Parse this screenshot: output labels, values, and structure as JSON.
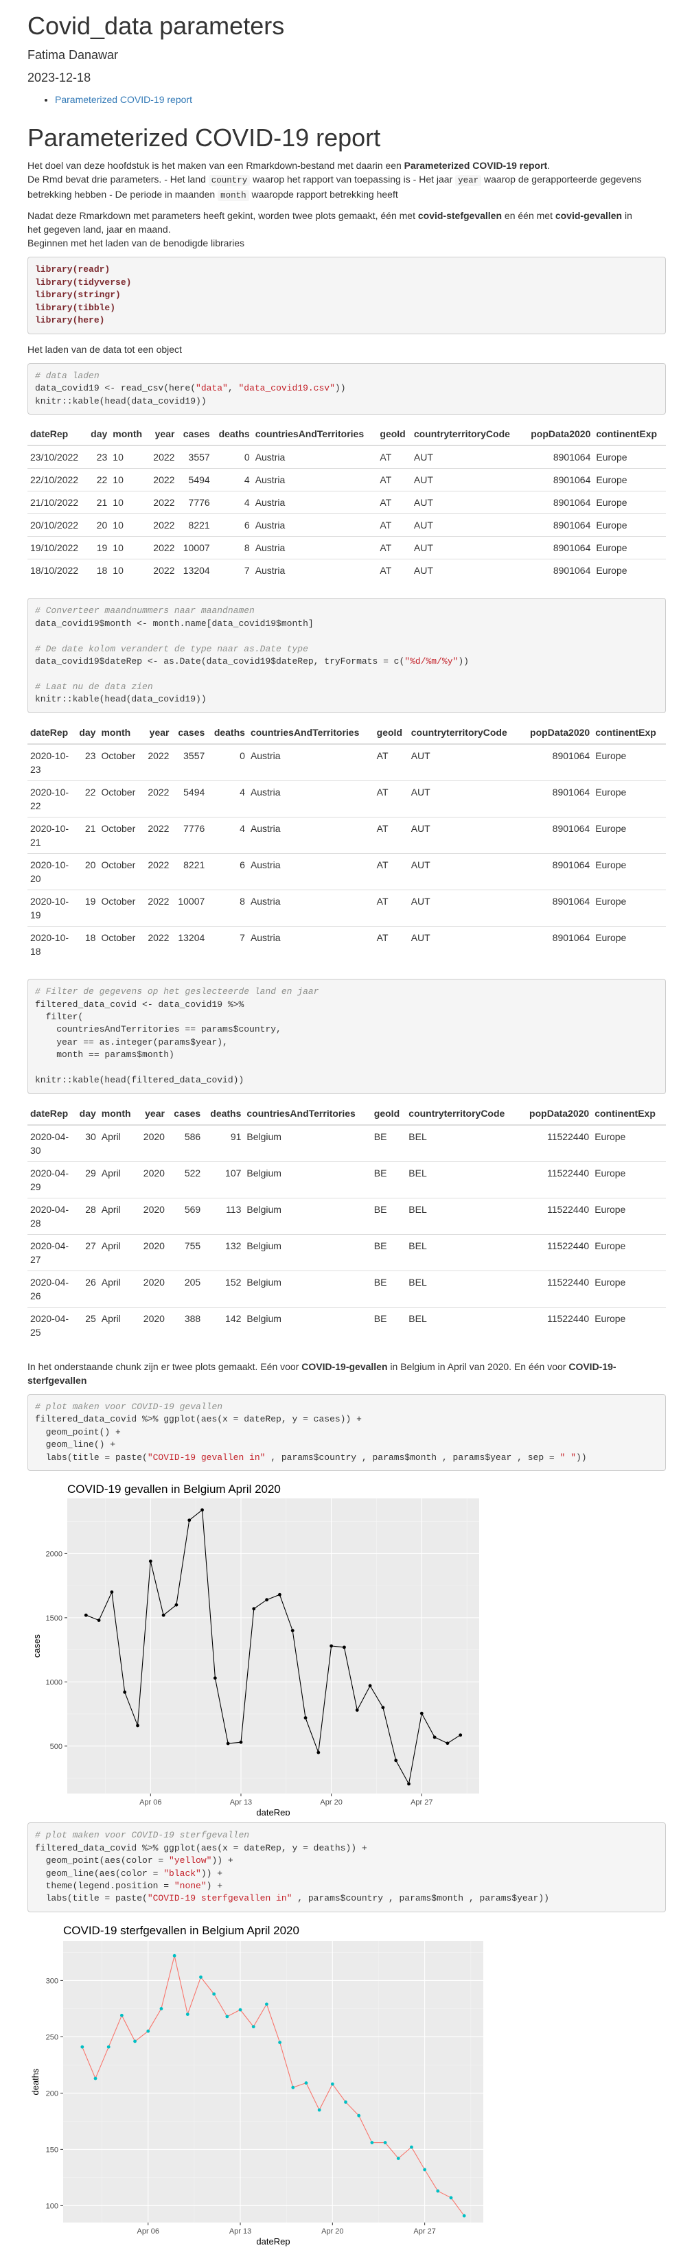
{
  "title": "Covid_data parameters",
  "author": "Fatima Danawar",
  "date": "2023-12-18",
  "toc": [
    "Parameterized COVID-19 report"
  ],
  "section_title": "Parameterized COVID-19 report",
  "intro": {
    "p1_a": "Het doel van deze hoofdstuk is het maken van een Rmarkdown-bestand met daarin een ",
    "p1_b": "Parameterized COVID-19 report",
    "p1_c": ".",
    "p1_d": "De Rmd bevat drie parameters. - Het land ",
    "p1_code1": "country",
    "p1_e": " waarop het rapport van toepassing is - Het jaar ",
    "p1_code2": "year",
    "p1_f": " waarop de gerapporteerde gegevens betrekking hebben - De periode in maanden ",
    "p1_code3": "month",
    "p1_g": " waaropde rapport betrekking heeft",
    "p2_a": "Nadat deze Rmarkdown met parameters heeft gekint, worden twee plots gemaakt, één met ",
    "p2_b": "covid-stefgevallen",
    "p2_c": " en één met ",
    "p2_d": "covid-gevallen",
    "p2_e": " in het gegeven land, jaar en maand.",
    "p2_f": "Beginnen met het laden van de benodigde libraries",
    "p3": "Het laden van de data tot een object",
    "p4_a": "In het onderstaande chunk zijn er twee plots gemaakt. Eén voor ",
    "p4_b": "COVID-19-gevallen",
    "p4_c": " in Belgium in April van 2020. En één voor ",
    "p4_d": "COVID-19-sterfgevallen"
  },
  "code": {
    "libs": [
      "library(readr)",
      "library(tidyverse)",
      "library(stringr)",
      "library(tibble)",
      "library(here)"
    ],
    "load_comment": "# data laden",
    "load_a": "data_covid19 <- read_csv(here(",
    "load_s1": "\"data\"",
    "load_b": ", ",
    "load_s2": "\"data_covid19.csv\"",
    "load_c": "))",
    "load_d": "knitr::kable(head(data_covid19))",
    "conv_c1": "# Converteer maandnummers naar maandnamen",
    "conv_1": "data_covid19$month <- month.name[data_covid19$month]",
    "conv_c2": "# De date kolom verandert de type naar as.Date type",
    "conv_2a": "data_covid19$dateRep <- as.Date(data_covid19$dateRep, tryFormats = c(",
    "conv_2s": "\"%d/%m/%y\"",
    "conv_2b": "))",
    "conv_c3": "# Laat nu de data zien",
    "conv_3": "knitr::kable(head(data_covid19))",
    "filt_c": "# Filter de gegevens op het geslecteerde land en jaar",
    "filt_1": "filtered_data_covid <- data_covid19 %>%",
    "filt_2": "  filter(",
    "filt_3": "    countriesAndTerritories == params$country,",
    "filt_4": "    year == as.integer(params$year),",
    "filt_5": "    month == params$month)",
    "filt_6": "knitr::kable(head(filtered_data_covid))",
    "p1_c": "# plot maken voor COVID-19 gevallen",
    "p1_1": "filtered_data_covid %>% ggplot(aes(x = dateRep, y = cases)) +",
    "p1_2": "  geom_point() +",
    "p1_3": "  geom_line() +",
    "p1_4a": "  labs(title = paste(",
    "p1_4s": "\"COVID-19 gevallen in\"",
    "p1_4b": " , params$country , params$month , params$year , sep = ",
    "p1_4s2": "\" \"",
    "p1_4c": "))",
    "p2_c": "# plot maken voor COVID-19 sterfgevallen",
    "p2_1": "filtered_data_covid %>% ggplot(aes(x = dateRep, y = deaths)) +",
    "p2_2a": "  geom_point(aes(color = ",
    "p2_2s": "\"yellow\"",
    "p2_2b": ")) +",
    "p2_3a": "  geom_line(aes(color = ",
    "p2_3s": "\"black\"",
    "p2_3b": ")) +",
    "p2_4a": "  theme(legend.position = ",
    "p2_4s": "\"none\"",
    "p2_4b": ") +",
    "p2_5a": "  labs(title = paste(",
    "p2_5s": "\"COVID-19 sterfgevallen in\"",
    "p2_5b": " , params$country , params$month , params$year))"
  },
  "tables": {
    "headers": [
      "dateRep",
      "day",
      "month",
      "year",
      "cases",
      "deaths",
      "countriesAndTerritories",
      "geoId",
      "countryterritoryCode",
      "popData2020",
      "continentExp"
    ],
    "t1": [
      [
        "23/10/2022",
        "23",
        "10",
        "2022",
        "3557",
        "0",
        "Austria",
        "AT",
        "AUT",
        "8901064",
        "Europe"
      ],
      [
        "22/10/2022",
        "22",
        "10",
        "2022",
        "5494",
        "4",
        "Austria",
        "AT",
        "AUT",
        "8901064",
        "Europe"
      ],
      [
        "21/10/2022",
        "21",
        "10",
        "2022",
        "7776",
        "4",
        "Austria",
        "AT",
        "AUT",
        "8901064",
        "Europe"
      ],
      [
        "20/10/2022",
        "20",
        "10",
        "2022",
        "8221",
        "6",
        "Austria",
        "AT",
        "AUT",
        "8901064",
        "Europe"
      ],
      [
        "19/10/2022",
        "19",
        "10",
        "2022",
        "10007",
        "8",
        "Austria",
        "AT",
        "AUT",
        "8901064",
        "Europe"
      ],
      [
        "18/10/2022",
        "18",
        "10",
        "2022",
        "13204",
        "7",
        "Austria",
        "AT",
        "AUT",
        "8901064",
        "Europe"
      ]
    ],
    "t2": [
      [
        "2020-10-23",
        "23",
        "October",
        "2022",
        "3557",
        "0",
        "Austria",
        "AT",
        "AUT",
        "8901064",
        "Europe"
      ],
      [
        "2020-10-22",
        "22",
        "October",
        "2022",
        "5494",
        "4",
        "Austria",
        "AT",
        "AUT",
        "8901064",
        "Europe"
      ],
      [
        "2020-10-21",
        "21",
        "October",
        "2022",
        "7776",
        "4",
        "Austria",
        "AT",
        "AUT",
        "8901064",
        "Europe"
      ],
      [
        "2020-10-20",
        "20",
        "October",
        "2022",
        "8221",
        "6",
        "Austria",
        "AT",
        "AUT",
        "8901064",
        "Europe"
      ],
      [
        "2020-10-19",
        "19",
        "October",
        "2022",
        "10007",
        "8",
        "Austria",
        "AT",
        "AUT",
        "8901064",
        "Europe"
      ],
      [
        "2020-10-18",
        "18",
        "October",
        "2022",
        "13204",
        "7",
        "Austria",
        "AT",
        "AUT",
        "8901064",
        "Europe"
      ]
    ],
    "t3": [
      [
        "2020-04-30",
        "30",
        "April",
        "2020",
        "586",
        "91",
        "Belgium",
        "BE",
        "BEL",
        "11522440",
        "Europe"
      ],
      [
        "2020-04-29",
        "29",
        "April",
        "2020",
        "522",
        "107",
        "Belgium",
        "BE",
        "BEL",
        "11522440",
        "Europe"
      ],
      [
        "2020-04-28",
        "28",
        "April",
        "2020",
        "569",
        "113",
        "Belgium",
        "BE",
        "BEL",
        "11522440",
        "Europe"
      ],
      [
        "2020-04-27",
        "27",
        "April",
        "2020",
        "755",
        "132",
        "Belgium",
        "BE",
        "BEL",
        "11522440",
        "Europe"
      ],
      [
        "2020-04-26",
        "26",
        "April",
        "2020",
        "205",
        "152",
        "Belgium",
        "BE",
        "BEL",
        "11522440",
        "Europe"
      ],
      [
        "2020-04-25",
        "25",
        "April",
        "2020",
        "388",
        "142",
        "Belgium",
        "BE",
        "BEL",
        "11522440",
        "Europe"
      ]
    ]
  },
  "chart_data": [
    {
      "type": "line",
      "title": "COVID-19 gevallen in Belgium April 2020",
      "xlabel": "dateRep",
      "ylabel": "cases",
      "x": [
        "2020-04-01",
        "2020-04-02",
        "2020-04-03",
        "2020-04-04",
        "2020-04-05",
        "2020-04-06",
        "2020-04-07",
        "2020-04-08",
        "2020-04-09",
        "2020-04-10",
        "2020-04-11",
        "2020-04-12",
        "2020-04-13",
        "2020-04-14",
        "2020-04-15",
        "2020-04-16",
        "2020-04-17",
        "2020-04-18",
        "2020-04-19",
        "2020-04-20",
        "2020-04-21",
        "2020-04-22",
        "2020-04-23",
        "2020-04-24",
        "2020-04-25",
        "2020-04-26",
        "2020-04-27",
        "2020-04-28",
        "2020-04-29",
        "2020-04-30"
      ],
      "values": [
        1520,
        1480,
        1700,
        920,
        660,
        1940,
        1520,
        1600,
        2260,
        2340,
        1030,
        520,
        530,
        1570,
        1640,
        1680,
        1400,
        720,
        450,
        1280,
        1270,
        780,
        970,
        800,
        388,
        205,
        755,
        569,
        522,
        586
      ],
      "xticks": [
        "Apr 06",
        "Apr 13",
        "Apr 20",
        "Apr 27"
      ],
      "yticks": [
        500,
        1000,
        1500,
        2000
      ],
      "ylim": [
        130,
        2430
      ],
      "point_color": "#000000",
      "line_color": "#000000",
      "grid": true
    },
    {
      "type": "line",
      "title": "COVID-19 sterfgevallen in Belgium April 2020",
      "xlabel": "dateRep",
      "ylabel": "deaths",
      "x": [
        "2020-04-01",
        "2020-04-02",
        "2020-04-03",
        "2020-04-04",
        "2020-04-05",
        "2020-04-06",
        "2020-04-07",
        "2020-04-08",
        "2020-04-09",
        "2020-04-10",
        "2020-04-11",
        "2020-04-12",
        "2020-04-13",
        "2020-04-14",
        "2020-04-15",
        "2020-04-16",
        "2020-04-17",
        "2020-04-18",
        "2020-04-19",
        "2020-04-20",
        "2020-04-21",
        "2020-04-22",
        "2020-04-23",
        "2020-04-24",
        "2020-04-25",
        "2020-04-26",
        "2020-04-27",
        "2020-04-28",
        "2020-04-29",
        "2020-04-30"
      ],
      "values": [
        241,
        213,
        241,
        269,
        246,
        255,
        275,
        322,
        270,
        303,
        288,
        268,
        274,
        259,
        279,
        245,
        205,
        209,
        185,
        208,
        192,
        180,
        156,
        156,
        142,
        152,
        132,
        113,
        107,
        91
      ],
      "xticks": [
        "Apr 06",
        "Apr 13",
        "Apr 20",
        "Apr 27"
      ],
      "yticks": [
        100,
        150,
        200,
        250,
        300
      ],
      "ylim": [
        85,
        335
      ],
      "point_color": "#00BFC4",
      "line_color": "#F8766D",
      "grid": true
    }
  ]
}
